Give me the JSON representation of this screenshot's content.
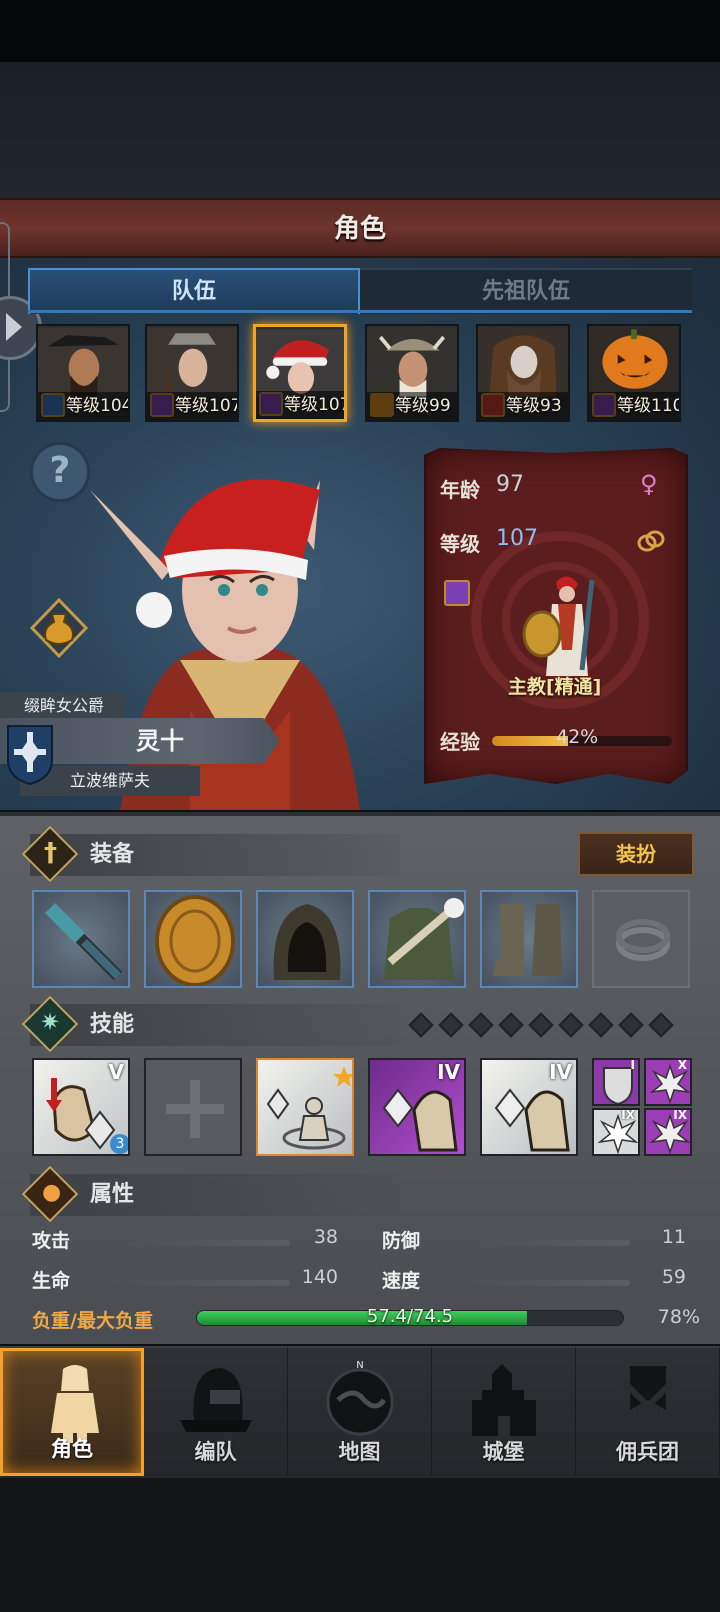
{
  "header": {
    "title": "角色"
  },
  "tabs": [
    {
      "label": "队伍",
      "active": true
    },
    {
      "label": "先祖队伍",
      "active": false
    }
  ],
  "heroes": [
    {
      "level_text": "等级104",
      "class_icon": "sword-icon",
      "class_color": "#3a6fb8",
      "selected": false
    },
    {
      "level_text": "等级107",
      "class_icon": "staff-icon",
      "class_color": "#7a3fb0",
      "selected": false
    },
    {
      "level_text": "等级107",
      "class_icon": "staff-icon",
      "class_color": "#7a3fb0",
      "selected": true
    },
    {
      "level_text": "等级99",
      "class_icon": "shield-icon",
      "class_color": "#d08b1f",
      "selected": false
    },
    {
      "level_text": "等级93",
      "class_icon": "beast-icon",
      "class_color": "#c0392b",
      "selected": false
    },
    {
      "level_text": "等级110",
      "class_icon": "staff-icon",
      "class_color": "#7a3fb0",
      "selected": false
    }
  ],
  "character": {
    "title": "缀眸女公爵",
    "name": "灵十",
    "location": "立波维萨夫",
    "age_label": "年龄",
    "age": "97",
    "level_label": "等级",
    "level": "107",
    "class_name": "主教[精通]",
    "exp_label": "经验",
    "exp_percent_text": "42%",
    "exp_fraction": 0.42,
    "gender_icon": "female-icon"
  },
  "equipment": {
    "title": "装备",
    "dress_button": "装扮",
    "slots": [
      "mace-icon",
      "round-shield-icon",
      "hood-icon",
      "robe-icon",
      "boots-icon",
      "ring-slot-icon"
    ]
  },
  "skills": {
    "title": "技能",
    "empty_slots": 9,
    "tiers": [
      "V",
      "",
      "",
      "IV",
      "IV"
    ],
    "badge": "3",
    "mini_tiers": [
      "I",
      "X",
      "IX",
      "IX"
    ]
  },
  "attributes": {
    "title": "属性",
    "attack_label": "攻击",
    "attack": "38",
    "defense_label": "防御",
    "defense": "11",
    "hp_label": "生命",
    "hp": "140",
    "speed_label": "速度",
    "speed": "59",
    "load_label": "负重/最大负重",
    "load_text": "57.4/74.5",
    "load_percent_text": "78%",
    "load_fraction": 0.774
  },
  "nav": [
    {
      "label": "角色",
      "active": true
    },
    {
      "label": "编队",
      "active": false
    },
    {
      "label": "地图",
      "active": false
    },
    {
      "label": "城堡",
      "active": false
    },
    {
      "label": "佣兵团",
      "active": false
    }
  ],
  "colors": {
    "accent_gold": "#f0a524",
    "blue_tab": "#4b8fd0",
    "load_green": "#2fb34a",
    "title_red": "#6e342d"
  }
}
